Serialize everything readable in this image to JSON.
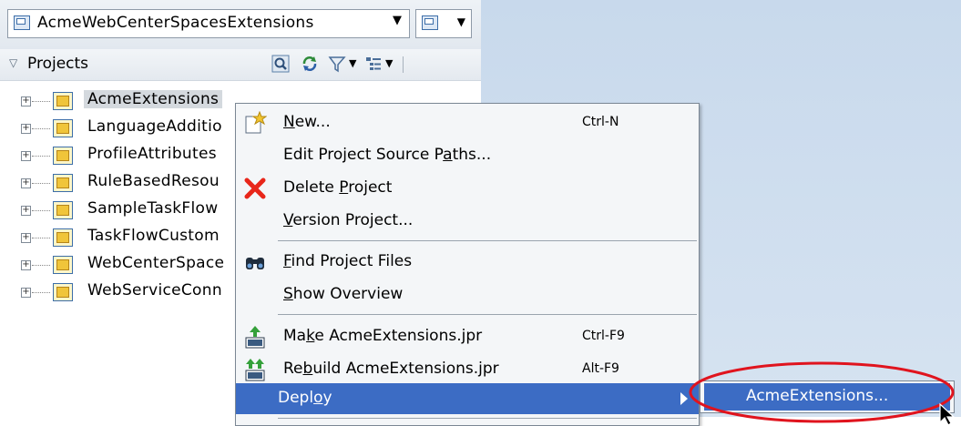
{
  "navigator": {
    "app_selector_label": "AcmeWebCenterSpacesExtensions",
    "projects_label": "Projects",
    "tree_items": [
      "AcmeExtensions",
      "LanguageAdditio",
      "ProfileAttributes",
      "RuleBasedResou",
      "SampleTaskFlow",
      "TaskFlowCustom",
      "WebCenterSpace",
      "WebServiceConn"
    ]
  },
  "context_menu": {
    "new_label_pre": "",
    "new_label_u": "N",
    "new_label_post": "ew...",
    "new_shortcut": "Ctrl-N",
    "edit_paths_pre": "Edit Project Source P",
    "edit_paths_u": "a",
    "edit_paths_post": "ths...",
    "delete_pre": "Delete ",
    "delete_u": "P",
    "delete_post": "roject",
    "version_pre": "",
    "version_u": "V",
    "version_post": "ersion Project...",
    "find_pre": "",
    "find_u": "F",
    "find_post": "ind Project Files",
    "overview_pre": "",
    "overview_u": "S",
    "overview_post": "how Overview",
    "make_pre": "Ma",
    "make_u": "k",
    "make_post": "e AcmeExtensions.jpr",
    "make_shortcut": "Ctrl-F9",
    "rebuild_pre": "Re",
    "rebuild_u": "b",
    "rebuild_post": "uild AcmeExtensions.jpr",
    "rebuild_shortcut": "Alt-F9",
    "deploy_pre": "Depl",
    "deploy_u": "o",
    "deploy_post": "y"
  },
  "submenu": {
    "item_label": "AcmeExtensions..."
  },
  "colors": {
    "highlight": "#3c6cc4",
    "annotation": "#e0141e"
  }
}
